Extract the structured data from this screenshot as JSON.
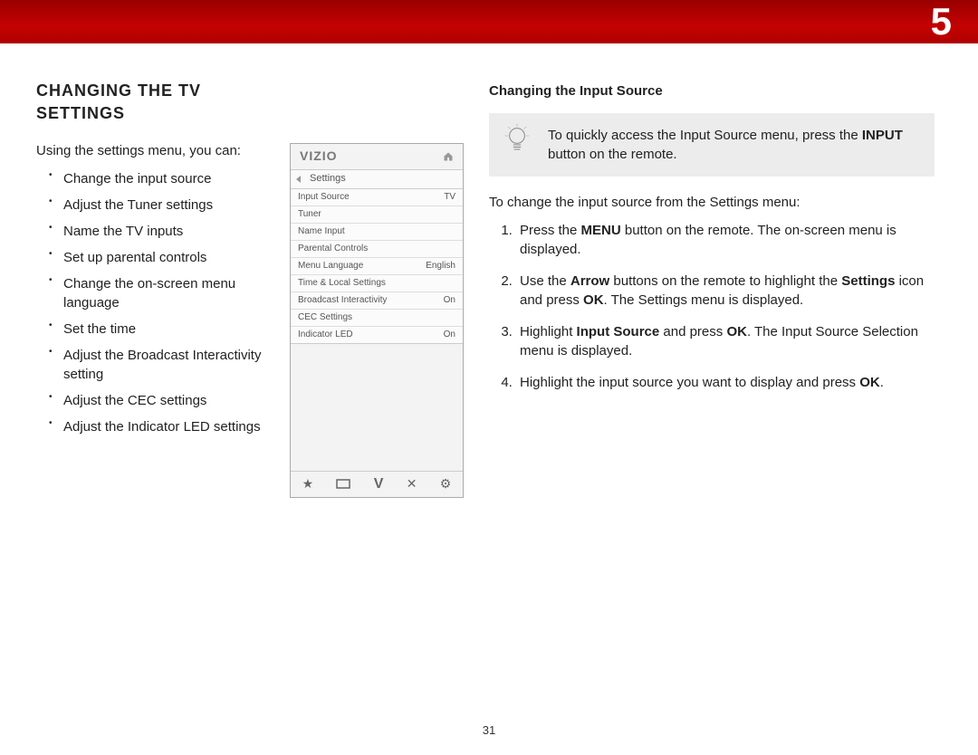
{
  "banner": {
    "chapter_number": "5"
  },
  "left": {
    "heading": "CHANGING THE TV SETTINGS",
    "intro": "Using the settings menu, you can:",
    "bullets": [
      "Change the input source",
      "Adjust the Tuner settings",
      "Name the TV inputs",
      "Set up parental controls",
      "Change the on-screen menu language",
      "Set the time",
      "Adjust the Broadcast Interactivity setting",
      "Adjust the CEC settings",
      "Adjust the Indicator LED settings"
    ]
  },
  "device": {
    "brand": "VIZIO",
    "crumb": "Settings",
    "rows": [
      {
        "label": "Input Source",
        "value": "TV"
      },
      {
        "label": "Tuner",
        "value": ""
      },
      {
        "label": "Name Input",
        "value": ""
      },
      {
        "label": "Parental Controls",
        "value": ""
      },
      {
        "label": "Menu Language",
        "value": "English"
      },
      {
        "label": "Time & Local Settings",
        "value": ""
      },
      {
        "label": "Broadcast Interactivity",
        "value": "On"
      },
      {
        "label": "CEC Settings",
        "value": ""
      },
      {
        "label": "Indicator LED",
        "value": "On"
      }
    ],
    "bottom_icons": [
      "star-icon",
      "screen-icon",
      "v-icon",
      "close-icon",
      "gear-icon"
    ]
  },
  "right": {
    "sub_heading": "Changing the Input Source",
    "tip_pre": "To quickly access the Input Source menu, press the ",
    "tip_bold": "INPUT",
    "tip_post": " button on the remote.",
    "after_tip": "To change the input source from the Settings menu:",
    "steps": [
      {
        "pre": "Press the ",
        "b1": "MENU",
        "mid": " button on the remote. The on-screen menu is displayed.",
        "b2": "",
        "mid2": "",
        "b3": "",
        "post": ""
      },
      {
        "pre": "Use the ",
        "b1": "Arrow",
        "mid": " buttons on the remote to highlight the ",
        "b2": "Settings",
        "mid2": " icon and press ",
        "b3": "OK",
        "post": ". The Settings menu is displayed."
      },
      {
        "pre": "Highlight ",
        "b1": "Input Source",
        "mid": " and press ",
        "b2": "OK",
        "mid2": ". The Input Source Selection menu is displayed.",
        "b3": "",
        "post": ""
      },
      {
        "pre": "Highlight the input source you want to display and press ",
        "b1": "OK",
        "mid": ".",
        "b2": "",
        "mid2": "",
        "b3": "",
        "post": ""
      }
    ]
  },
  "page_number": "31"
}
